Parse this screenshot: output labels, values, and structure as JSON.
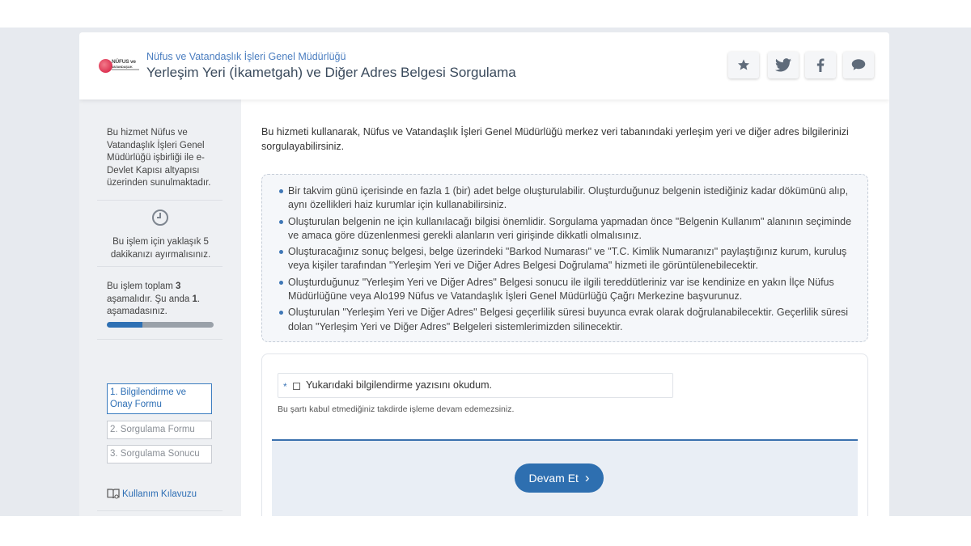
{
  "header": {
    "subtitle": "Nüfus ve Vatandaşlık İşleri Genel Müdürlüğü",
    "title": "Yerleşim Yeri (İkametgah) ve Diğer Adres Belgesi Sorgulama",
    "logo_text_1": "NÜFUS ve",
    "logo_text_2": "VATANDAŞLIK"
  },
  "sidebar": {
    "intro": "Bu hizmet Nüfus ve Vatandaşlık İşleri Genel Müdürlüğü işbirliği ile e-Devlet Kapısı altyapısı üzerinden sunulmaktadır.",
    "time_note": "Bu işlem için yaklaşık 5 dakikanızı ayırmalısınız.",
    "steps_text_a": "Bu işlem toplam ",
    "steps_total": "3",
    "steps_text_b": " aşamalıdır. Şu anda ",
    "steps_current": "1",
    "steps_text_c": ". aşamadasınız.",
    "progress_fraction": 0.333,
    "steps": [
      "1. Bilgilendirme ve Onay Formu",
      "2. Sorgulama Formu",
      "3. Sorgulama Sonucu"
    ],
    "guide": "Kullanım Kılavuzu"
  },
  "main": {
    "intro": "Bu hizmeti kullanarak, Nüfus ve Vatandaşlık İşleri Genel Müdürlüğü merkez veri tabanındaki yerleşim yeri ve diğer adres bilgilerinizi sorgulayabilirsiniz.",
    "info": [
      "Bir takvim günü içerisinde en fazla 1 (bir) adet belge oluşturulabilir. Oluşturduğunuz belgenin istediğiniz kadar dökümünü alıp, aynı özellikleri haiz kurumlar için kullanabilirsiniz.",
      "Oluşturulan belgenin ne için kullanılacağı bilgisi önemlidir. Sorgulama yapmadan önce \"Belgenin Kullanım\" alanının seçiminde ve amaca göre düzenlenmesi gerekli alanların veri girişinde dikkatli olmalısınız.",
      "Oluşturacağınız sonuç belgesi, belge üzerindeki \"Barkod Numarası\" ve \"T.C. Kimlik Numaranızı\" paylaştığınız kurum, kuruluş veya kişiler tarafından \"Yerleşim Yeri ve Diğer Adres Belgesi Doğrulama\" hizmeti ile görüntülenebilecektir.",
      "Oluşturduğunuz \"Yerleşim Yeri ve Diğer Adres\" Belgesi sonucu ile ilgili tereddütleriniz var ise kendinize en yakın İlçe Nüfus Müdürlüğüne veya Alo199 Nüfus ve Vatandaşlık İşleri Genel Müdürlüğü Çağrı Merkezine başvurunuz.",
      "Oluşturulan \"Yerleşim Yeri ve Diğer Adres\" Belgesi geçerlilik süresi buyunca evrak olarak doğrulanabilecektir. Geçerlilik süresi dolan \"Yerleşim Yeri ve Diğer Adres\" Belgeleri sistemlerimizden silinecektir."
    ],
    "required_mark": "*",
    "checkbox_label": "Yukarıdaki bilgilendirme yazısını okudum.",
    "checkbox_checked": false,
    "note": "Bu şartı kabul etmediğiniz takdirde işleme devam edemezsiniz.",
    "continue_button": "Devam Et",
    "continue_arrow": "›"
  },
  "colors": {
    "accent": "#2e6fb0",
    "sidebar_bg": "#eef0f3",
    "page_bg": "#e7eaef"
  },
  "icons": [
    "star-icon",
    "twitter-icon",
    "facebook-icon",
    "chat-icon",
    "clock-icon",
    "book-icon"
  ]
}
